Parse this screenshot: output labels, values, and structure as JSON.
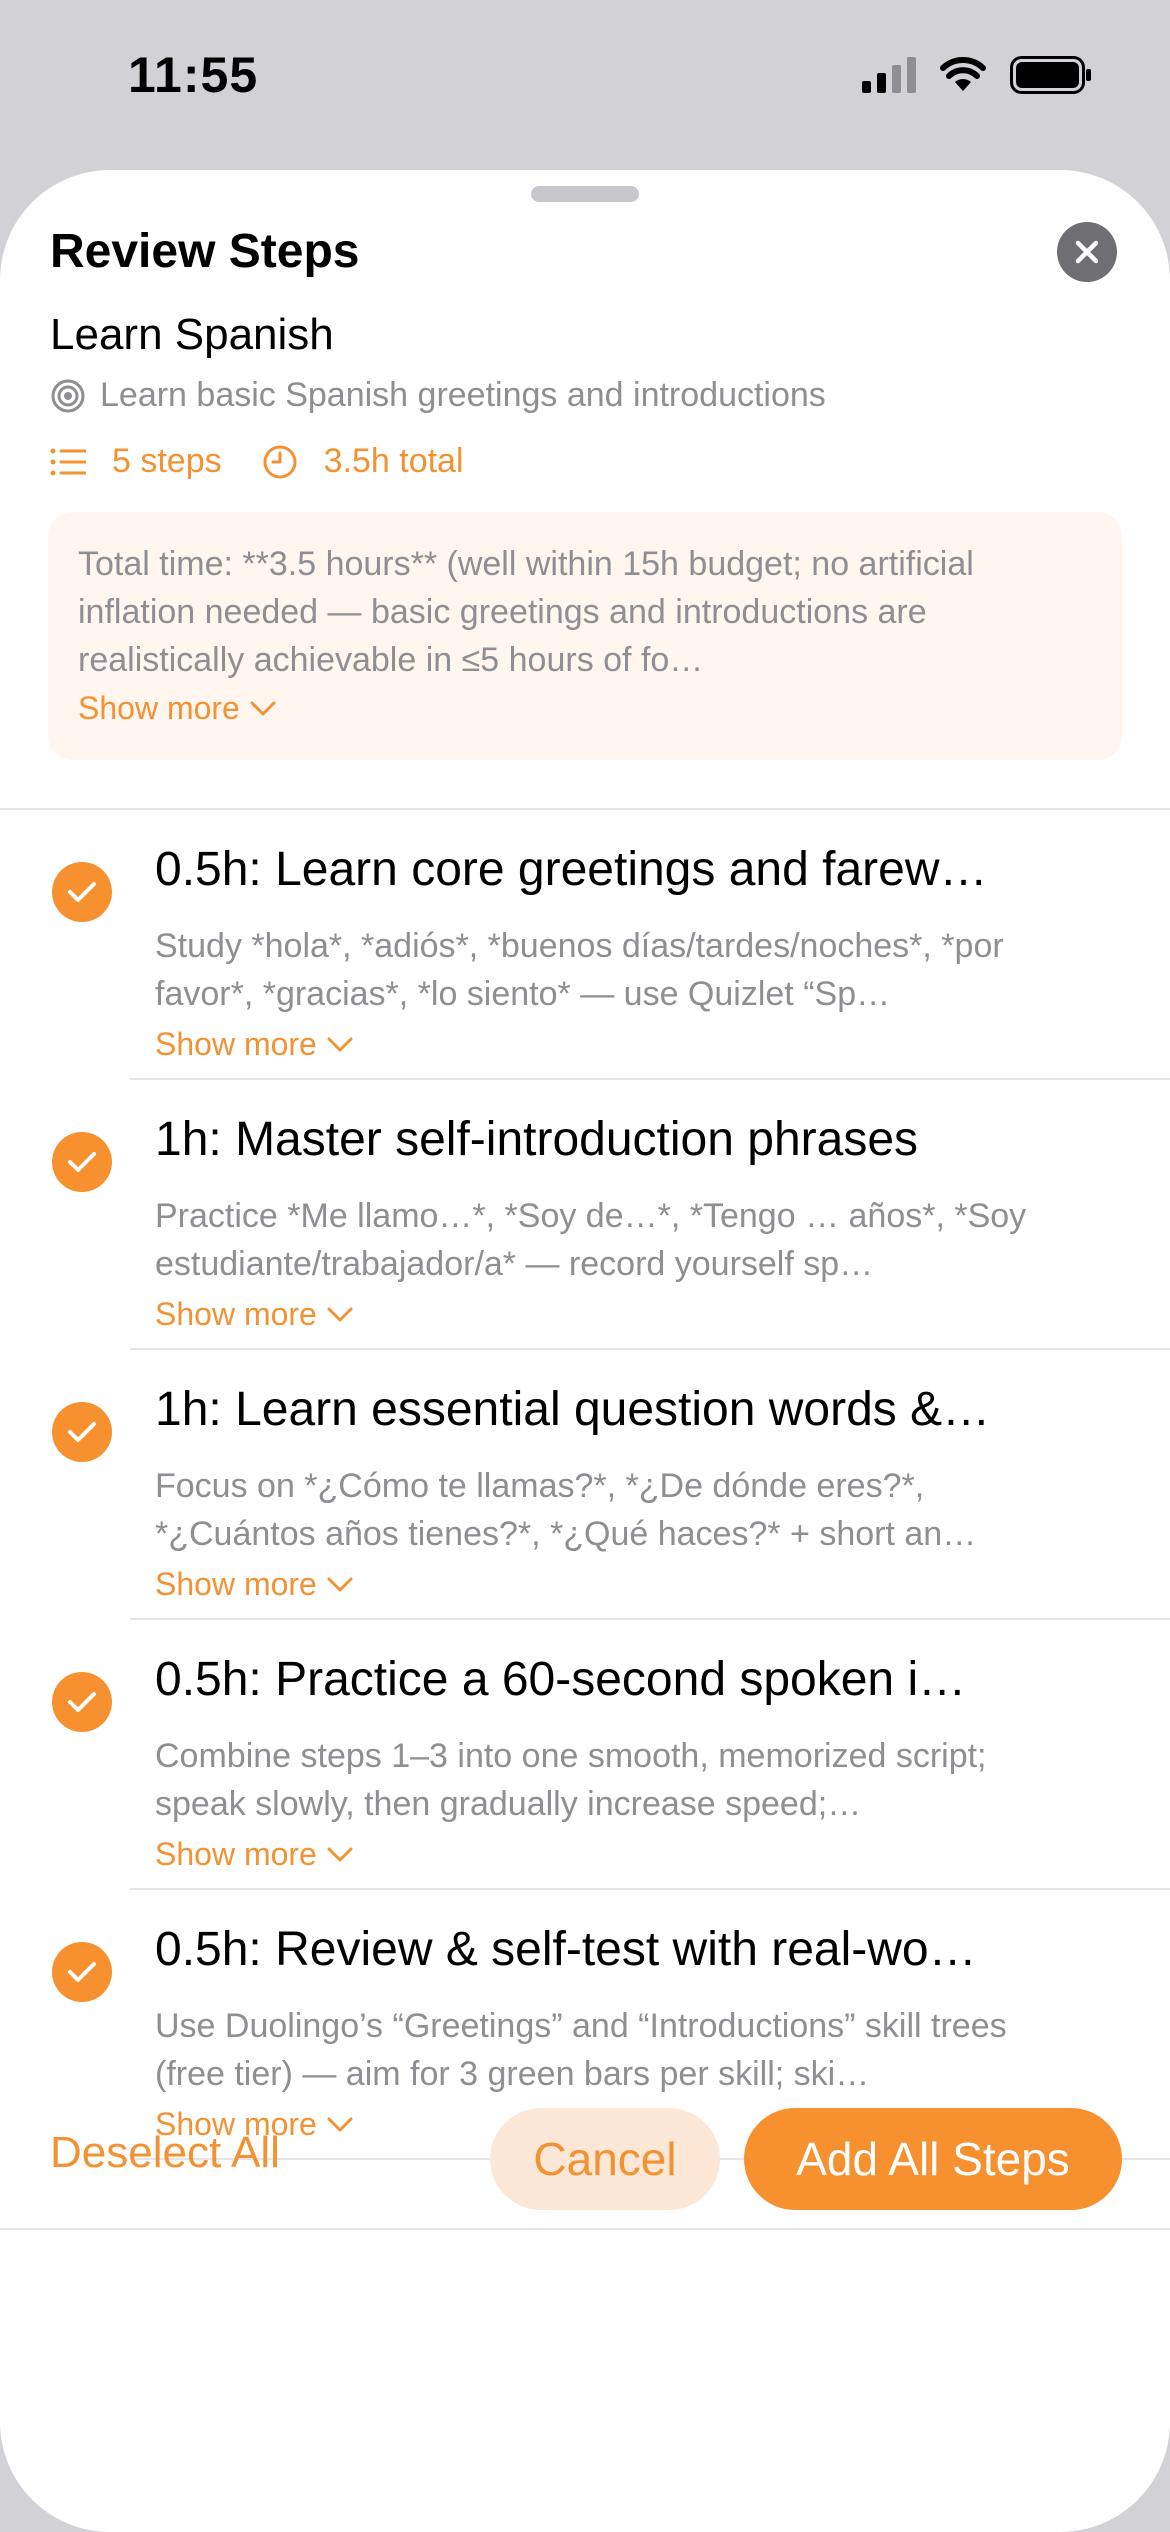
{
  "status_bar": {
    "time": "11:55"
  },
  "sheet": {
    "title": "Review Steps",
    "goal_title": "Learn Spanish",
    "goal_description": "Learn basic Spanish greetings and introductions",
    "steps_count": "5 steps",
    "total_time": "3.5h total",
    "note": "Total time: **3.5 hours** (well within 15h budget; no artificial inflation needed — basic greetings and introductions are realistically achievable in ≤5 hours of fo…",
    "show_more": "Show more"
  },
  "steps": [
    {
      "title": "0.5h: Learn core greetings and farew…",
      "description": "Study *hola*, *adiós*, *buenos días/tardes/noches*, *por favor*, *gracias*, *lo siento* — use Quizlet “Sp…",
      "show_more": "Show more",
      "checked": true
    },
    {
      "title": "1h: Master self-introduction phrases",
      "description": "Practice *Me llamo…*, *Soy de…*, *Tengo … años*, *Soy estudiante/trabajador/a* — record yourself sp…",
      "show_more": "Show more",
      "checked": true
    },
    {
      "title": "1h: Learn essential question words &…",
      "description": "Focus on *¿Cómo te llamas?*, *¿De dónde eres?*, *¿Cuántos años tienes?*, *¿Qué haces?* + short an…",
      "show_more": "Show more",
      "checked": true
    },
    {
      "title": "0.5h: Practice a 60-second spoken i…",
      "description": "Combine steps 1–3 into one smooth, memorized script; speak slowly, then gradually increase speed;…",
      "show_more": "Show more",
      "checked": true
    },
    {
      "title": "0.5h: Review & self-test with real-wo…",
      "description": "Use Duolingo’s “Greetings” and “Introductions” skill trees (free tier) — aim for 3 green bars per skill; ski…",
      "show_more": "Show more",
      "checked": true
    }
  ],
  "footer": {
    "deselect_all": "Deselect All",
    "cancel": "Cancel",
    "add_all": "Add All Steps"
  },
  "colors": {
    "accent": "#f7902f",
    "accent_text": "#f39233",
    "note_bg": "#fff6ef",
    "cancel_bg": "#fde7d6",
    "secondary_text": "#8e8e93"
  }
}
